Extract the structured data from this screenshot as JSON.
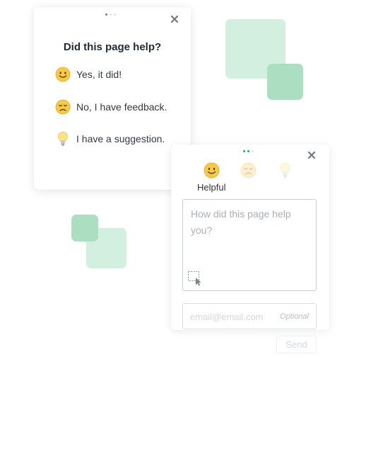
{
  "colors": {
    "accent": "#2eaa5b",
    "square_light": "#d3efdf",
    "square_mid": "#acdfc2"
  },
  "card1": {
    "title": "Did this page help?",
    "options": [
      {
        "icon": "smiley-face-icon",
        "label": "Yes, it did!"
      },
      {
        "icon": "sad-face-icon",
        "label": "No, I have feedback."
      },
      {
        "icon": "lightbulb-icon",
        "label": "I have a suggestion."
      }
    ]
  },
  "card2": {
    "faces": [
      "smiley-face-icon",
      "sad-face-icon",
      "lightbulb-icon"
    ],
    "selected_label": "Helpful",
    "textarea": {
      "placeholder": "How did this page help you?"
    },
    "email": {
      "placeholder": "email@email.com",
      "optional_label": "Optional"
    },
    "send_label": "Send"
  }
}
